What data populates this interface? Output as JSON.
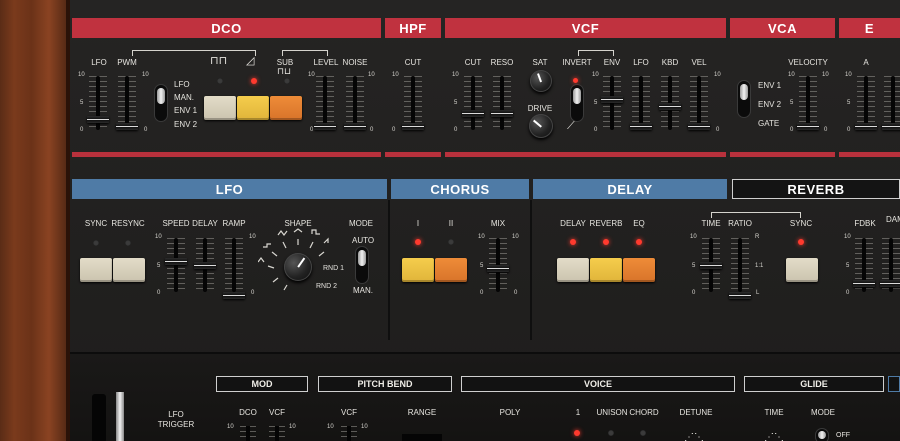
{
  "sections": {
    "dco": "DCO",
    "hpf": "HPF",
    "vcf": "VCF",
    "vca": "VCA",
    "env": "E",
    "lfo": "LFO",
    "chorus": "CHORUS",
    "delay": "DELAY",
    "reverb": "REVERB"
  },
  "dco": {
    "lfo": "LFO",
    "pwm": "PWM",
    "sub": "SUB",
    "level": "LEVEL",
    "noise": "NOISE",
    "src": [
      "LFO",
      "MAN.",
      "ENV 1",
      "ENV 2"
    ],
    "pulse_icon": "square-wave-icon",
    "saw_icon": "sawtooth-wave-icon",
    "sub_icon": "sub-square-icon"
  },
  "hpf": {
    "cut": "CUT"
  },
  "vcf": {
    "cut": "CUT",
    "reso": "RESO",
    "sat": "SAT",
    "drive": "DRIVE",
    "invert": "INVERT",
    "env": "ENV",
    "lfo": "LFO",
    "kbd": "KBD",
    "vel": "VEL"
  },
  "vca": {
    "velocity": "VELOCITY",
    "modes": [
      "ENV 1",
      "ENV 2",
      "GATE"
    ]
  },
  "env": {
    "a": "A"
  },
  "lfo": {
    "sync": "SYNC",
    "resync": "RESYNC",
    "speed": "SPEED",
    "delay": "DELAY",
    "ramp": "RAMP",
    "shape": "SHAPE",
    "mode": "MODE",
    "auto": "AUTO",
    "man": "MAN.",
    "rnd1": "RND 1",
    "rnd2": "RND 2"
  },
  "chorus": {
    "i": "I",
    "ii": "II",
    "mix": "MIX"
  },
  "delay": {
    "delay": "DELAY",
    "reverb": "REVERB",
    "eq": "EQ"
  },
  "reverb": {
    "time": "TIME",
    "ratio": "RATIO",
    "sync": "SYNC",
    "fdbk": "FDBK",
    "dam": "DAM",
    "r": "R",
    "l": "L",
    "mid": "1:1"
  },
  "scale": {
    "top": "10",
    "mid": "5",
    "bot": "0"
  },
  "lower": {
    "mod": "MOD",
    "pitch_bend": "PITCH BEND",
    "voice": "VOICE",
    "glide": "GLIDE",
    "lfo_trigger_1": "LFO",
    "lfo_trigger_2": "TRIGGER",
    "dco": "DCO",
    "vcf_a": "VCF",
    "vcf_b": "VCF",
    "range": "RANGE",
    "poly": "POLY",
    "one": "1",
    "unison": "UNISON",
    "chord": "CHORD",
    "detune": "DETUNE",
    "time": "TIME",
    "mode": "MODE",
    "off": "OFF"
  }
}
